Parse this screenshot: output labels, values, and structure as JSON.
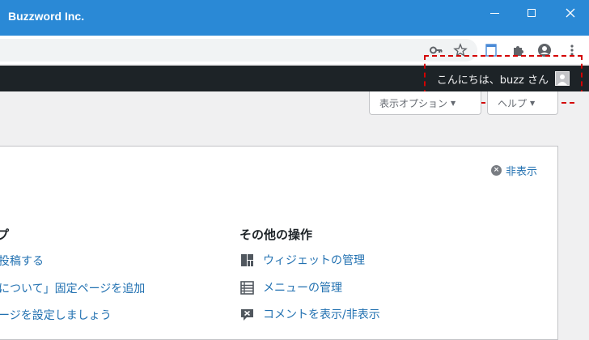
{
  "window": {
    "title": "Buzzword Inc."
  },
  "adminbar": {
    "greeting": "こんにちは、buzz さん"
  },
  "screen_options": {
    "display_label": "表示オプション",
    "help_label": "ヘルプ",
    "caret": "▼"
  },
  "welcome": {
    "dismiss_label": "非表示",
    "left_heading": "プ",
    "left_links": [
      "投稿する",
      "について」固定ページを追加",
      "ージを設定しましょう"
    ],
    "right_heading": "その他の操作",
    "actions": [
      {
        "icon": "widgets-icon",
        "label": "ウィジェットの管理"
      },
      {
        "icon": "menu-icon",
        "label": "メニューの管理"
      },
      {
        "icon": "comments-icon",
        "label": "コメントを表示/非表示"
      }
    ]
  },
  "colors": {
    "titlebar": "#2a89d6",
    "adminbar": "#1d2327",
    "link": "#2271b1",
    "annotation": "#d40000"
  }
}
